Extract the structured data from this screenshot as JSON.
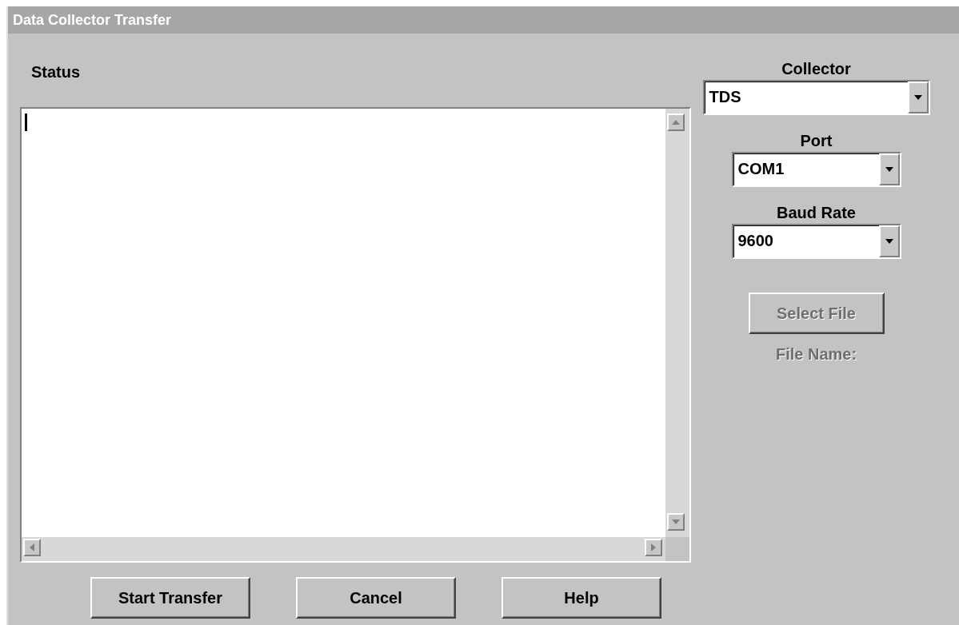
{
  "window": {
    "title": "Data Collector Transfer"
  },
  "status": {
    "label": "Status"
  },
  "collector": {
    "label": "Collector",
    "value": "TDS"
  },
  "port": {
    "label": "Port",
    "value": "COM1"
  },
  "baud_rate": {
    "label": "Baud Rate",
    "value": "9600"
  },
  "select_file_button": {
    "label": "Select File",
    "disabled": true
  },
  "file_name": {
    "label": "File Name:",
    "disabled": true
  },
  "buttons": [
    {
      "label": "Start Transfer"
    },
    {
      "label": "Cancel"
    },
    {
      "label": "Help"
    }
  ]
}
